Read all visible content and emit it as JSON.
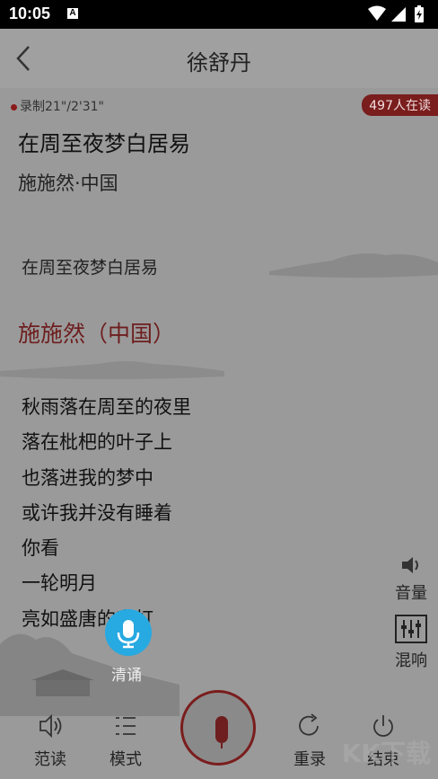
{
  "status_bar": {
    "time": "10:05",
    "notification_badge": "A"
  },
  "header": {
    "title": "徐舒丹"
  },
  "recording": {
    "label": "录制21\"/2'31\"",
    "readers": "497人在读"
  },
  "poem": {
    "title": "在周至夜梦白居易",
    "author_line": "施施然·中国",
    "subtitle": "在周至夜梦白居易",
    "section_title": "施施然（中国）",
    "lines": [
      "秋雨落在周至的夜里",
      "落在枇杷的叶子上",
      "也落进我的梦中",
      "或许我并没有睡着",
      "你看",
      "一轮明月",
      "亮如盛唐的宫灯"
    ]
  },
  "side_controls": {
    "volume": "音量",
    "mix": "混响"
  },
  "recite_button": {
    "label": "清诵",
    "color": "#27a9e1"
  },
  "bottom_bar": {
    "demo": "范读",
    "mode": "模式",
    "rerecord": "重录",
    "finish": "结束"
  },
  "watermark": "KK下载",
  "colors": {
    "accent": "#7a1d1d",
    "recite": "#27a9e1"
  }
}
